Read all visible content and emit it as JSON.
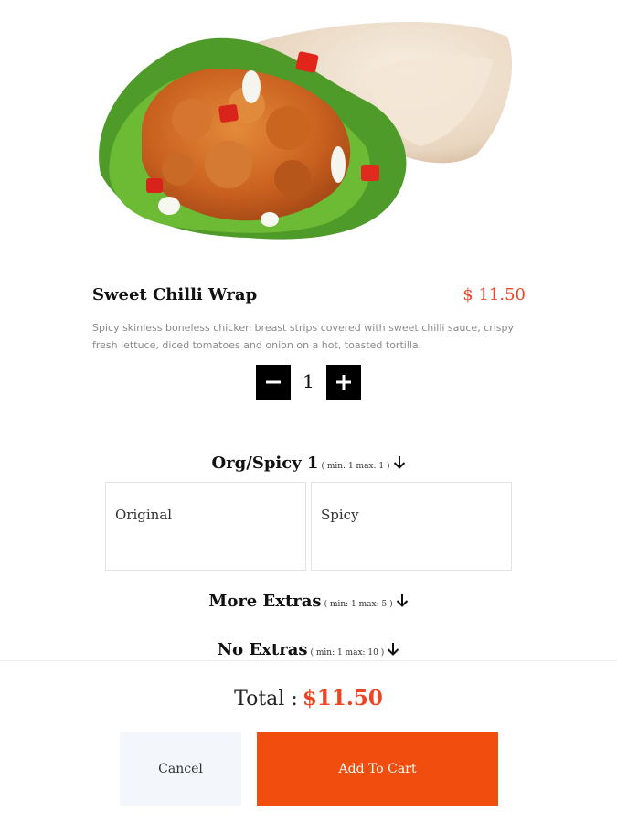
{
  "product": {
    "title": "Sweet Chilli Wrap",
    "price": "$ 11.50",
    "description": "Spicy skinless boneless chicken breast strips covered with sweet chilli sauce, crispy fresh lettuce, diced tomatoes and onion on a hot, toasted tortilla.",
    "image_icon": "chicken-wrap-image"
  },
  "quantity": {
    "value": "1",
    "minus_icon": "minus-icon",
    "plus_icon": "plus-icon"
  },
  "sections": [
    {
      "name": "Org/Spicy 1",
      "limits": "( min: 1 max: 1 )",
      "options": [
        "Original",
        "Spicy"
      ]
    },
    {
      "name": "More Extras",
      "limits": "( min: 1 max: 5 )"
    },
    {
      "name": "No Extras",
      "limits": "( min: 1 max: 10 )"
    }
  ],
  "footer": {
    "total_label": "Total :",
    "total_amount": "$11.50",
    "cancel_label": "Cancel",
    "add_to_cart_label": "Add To Cart"
  },
  "colors": {
    "accent": "#ee4423",
    "cart_button": "#f14d0e",
    "cancel_button": "#f3f7fb"
  }
}
